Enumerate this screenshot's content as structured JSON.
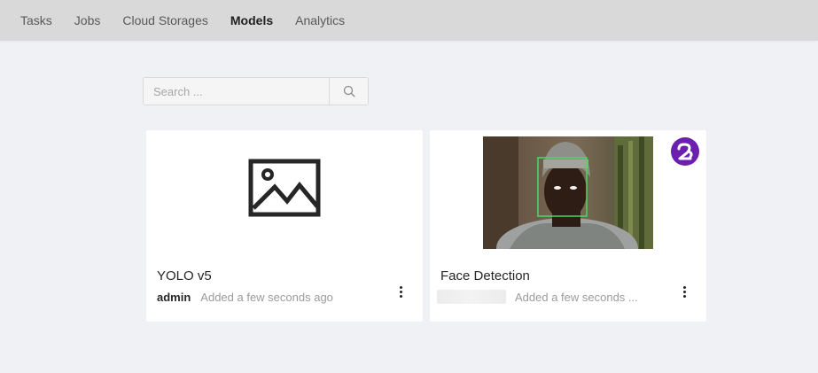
{
  "nav": {
    "items": [
      {
        "label": "Tasks",
        "active": false
      },
      {
        "label": "Jobs",
        "active": false
      },
      {
        "label": "Cloud Storages",
        "active": false
      },
      {
        "label": "Models",
        "active": true
      },
      {
        "label": "Analytics",
        "active": false
      }
    ]
  },
  "search": {
    "placeholder": "Search ...",
    "icon": "search-icon"
  },
  "models": [
    {
      "name": "YOLO v5",
      "owner": "admin",
      "added": "Added a few seconds ago",
      "preview_icon": "image-placeholder-icon"
    },
    {
      "name": "Face Detection",
      "owner": "",
      "added": "Added a few seconds ...",
      "provider_icon": "provider-logo-icon",
      "provider_color": "#6b1fb1"
    }
  ],
  "colors": {
    "topbar": "#d9d9d9",
    "background": "#f0f1f4",
    "card": "#ffffff",
    "face_box": "#4cd964"
  }
}
